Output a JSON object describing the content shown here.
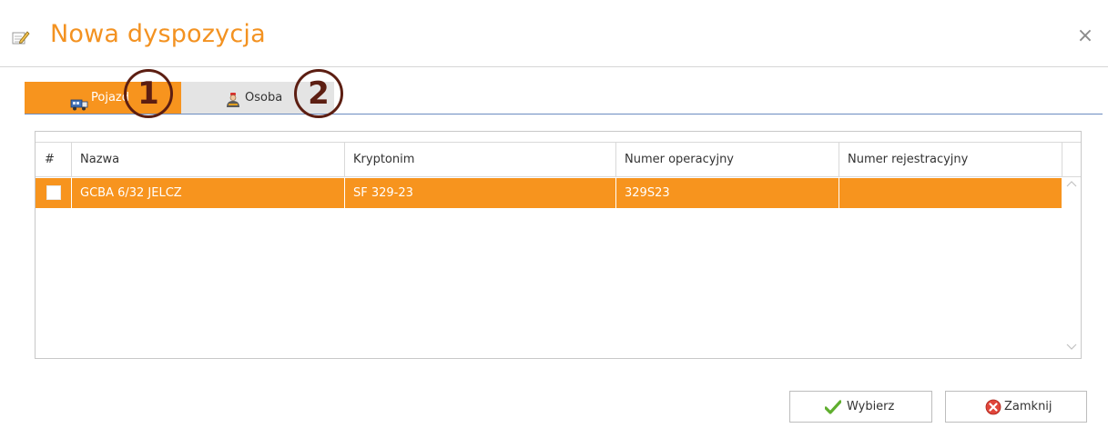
{
  "dialog": {
    "title": "Nowa dyspozycja",
    "title_icon": "edit-note-icon",
    "close_glyph": "×",
    "accent_color": "#f39221"
  },
  "tabs": [
    {
      "label": "Pojazd",
      "icon": "vehicle-icon",
      "active": true
    },
    {
      "label": "Osoba",
      "icon": "person-icon",
      "active": false
    }
  ],
  "callouts": [
    "1",
    "2"
  ],
  "table": {
    "columns": [
      "#",
      "Nazwa",
      "Kryptonim",
      "Numer operacyjny",
      "Numer rejestracyjny"
    ],
    "rows": [
      {
        "checked": false,
        "nazwa": "GCBA 6/32 JELCZ",
        "kryptonim": "SF 329-23",
        "numer_operacyjny": "329S23",
        "numer_rejestracyjny": ""
      }
    ],
    "selected_row_color": "#f7941e",
    "scroll_up_glyph": "︿",
    "scroll_down_glyph": "﹀"
  },
  "buttons": {
    "select_label": "Wybierz",
    "select_icon": "checkmark-icon",
    "close_label": "Zamknij",
    "close_icon": "close-circle-icon"
  }
}
